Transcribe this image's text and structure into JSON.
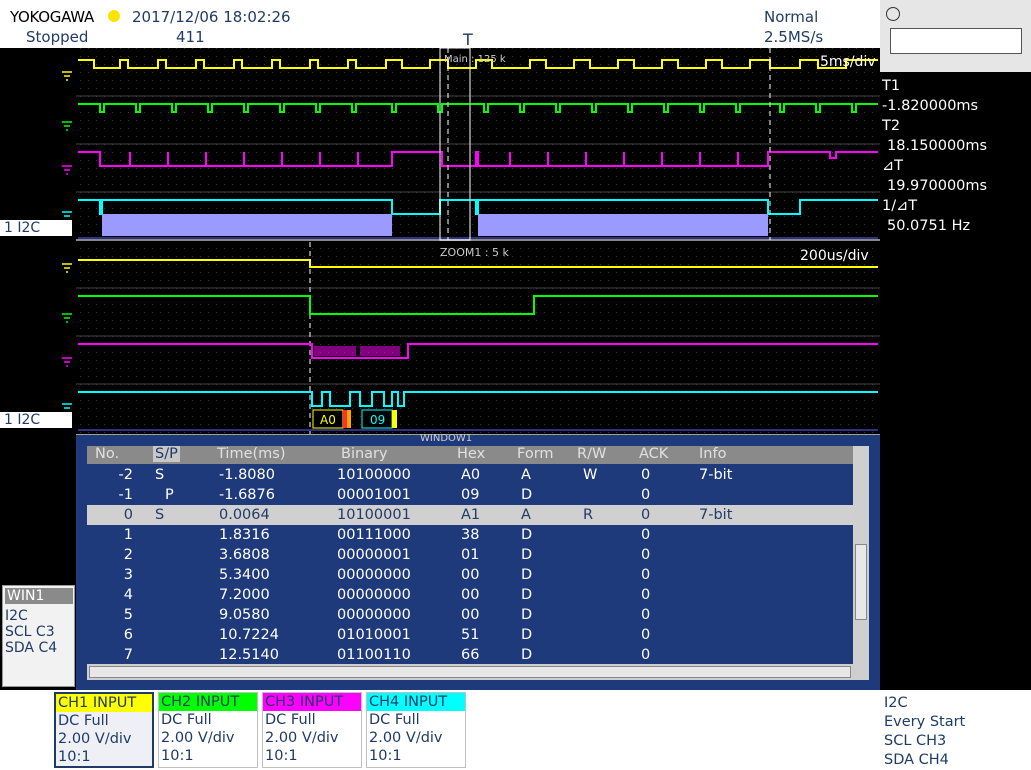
{
  "header": {
    "brand": "YOKOGAWA",
    "datetime": "2017/12/06 18:02:26",
    "state": "Stopped",
    "acq_count": "411",
    "trigger_mode": "Normal",
    "sample_rate": "2.5MS/s",
    "trigger_marker": "T"
  },
  "main_view": {
    "label": "Main : 125 k",
    "timebase": "5ms/div"
  },
  "zoom_view": {
    "label": "ZOOM1 : 5 k",
    "timebase": "200us/div"
  },
  "bus_label": "1 I2C",
  "cursors": {
    "t1_label": "T1",
    "t1_value": "-1.820000ms",
    "t2_label": "T2",
    "t2_value": "18.150000ms",
    "dt_label": "⊿T",
    "dt_value": "19.970000ms",
    "inv_dt_label": "1/⊿T",
    "inv_dt_value": "50.0751 Hz"
  },
  "decode_tags": [
    "A0",
    "09"
  ],
  "window": {
    "title": "WINDOW1",
    "columns": [
      "No.",
      "S/P",
      "Time(ms)",
      "Binary",
      "Hex",
      "Form",
      "R/W",
      "ACK",
      "Info"
    ],
    "rows": [
      {
        "no": "-2",
        "sp": "S",
        "time": "-1.8080",
        "binary": "10100000",
        "hex": "A0",
        "form": "A",
        "rw": "W",
        "ack": "0",
        "info": "7-bit"
      },
      {
        "no": "-1",
        "sp": "P",
        "time": "-1.6876",
        "binary": "00001001",
        "hex": "09",
        "form": "D",
        "rw": "",
        "ack": "0",
        "info": ""
      },
      {
        "no": "0",
        "sp": "S",
        "time": "0.0064",
        "binary": "10100001",
        "hex": "A1",
        "form": "A",
        "rw": "R",
        "ack": "0",
        "info": "7-bit"
      },
      {
        "no": "1",
        "sp": "",
        "time": "1.8316",
        "binary": "00111000",
        "hex": "38",
        "form": "D",
        "rw": "",
        "ack": "0",
        "info": ""
      },
      {
        "no": "2",
        "sp": "",
        "time": "3.6808",
        "binary": "00000001",
        "hex": "01",
        "form": "D",
        "rw": "",
        "ack": "0",
        "info": ""
      },
      {
        "no": "3",
        "sp": "",
        "time": "5.3400",
        "binary": "00000000",
        "hex": "00",
        "form": "D",
        "rw": "",
        "ack": "0",
        "info": ""
      },
      {
        "no": "4",
        "sp": "",
        "time": "7.2000",
        "binary": "00000000",
        "hex": "00",
        "form": "D",
        "rw": "",
        "ack": "0",
        "info": ""
      },
      {
        "no": "5",
        "sp": "",
        "time": "9.0580",
        "binary": "00000000",
        "hex": "00",
        "form": "D",
        "rw": "",
        "ack": "0",
        "info": ""
      },
      {
        "no": "6",
        "sp": "",
        "time": "10.7224",
        "binary": "01010001",
        "hex": "51",
        "form": "D",
        "rw": "",
        "ack": "0",
        "info": ""
      },
      {
        "no": "7",
        "sp": "",
        "time": "12.5140",
        "binary": "01100110",
        "hex": "66",
        "form": "D",
        "rw": "",
        "ack": "0",
        "info": ""
      }
    ],
    "selected_index": 2
  },
  "win1_panel": {
    "title": "WIN1",
    "lines": [
      "I2C",
      "SCL C3",
      "SDA C4"
    ]
  },
  "channels": [
    {
      "name": "CH1 INPUT",
      "coupling": "DC Full",
      "scale": "2.00 V/div",
      "probe": "10:1",
      "color": "#ffff00"
    },
    {
      "name": "CH2 INPUT",
      "coupling": "DC Full",
      "scale": "2.00 V/div",
      "probe": "10:1",
      "color": "#00ff00"
    },
    {
      "name": "CH3 INPUT",
      "coupling": "DC Full",
      "scale": "2.00 V/div",
      "probe": "10:1",
      "color": "#ff00ff"
    },
    {
      "name": "CH4 INPUT",
      "coupling": "DC Full",
      "scale": "2.00 V/div",
      "probe": "10:1",
      "color": "#00ffff"
    }
  ],
  "trigger_info": [
    "I2C",
    "Every Start",
    "SCL  CH3",
    "SDA  CH4"
  ],
  "colors": {
    "ch1": "#ffff00",
    "ch2": "#00ff00",
    "ch3": "#ff00ff",
    "ch4": "#00ffff",
    "bus_fill": "#9a9aff",
    "table_bg": "#1e3a7a",
    "text": "#1f3b66"
  }
}
